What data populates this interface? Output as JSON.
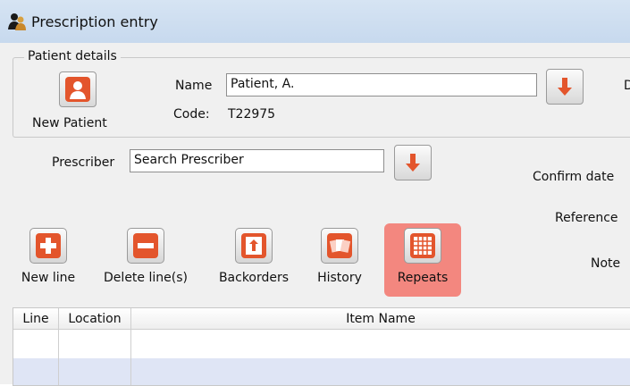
{
  "window": {
    "title": "Prescription entry",
    "app_icon": "people-icon"
  },
  "patient_details": {
    "legend": "Patient details",
    "new_patient_label": "New Patient",
    "name_label": "Name",
    "name_value": "Patient, A.",
    "code_label": "Code:",
    "code_value": "T22975",
    "cut_label": "D"
  },
  "prescriber": {
    "label": "Prescriber",
    "value": "Search Prescriber"
  },
  "right_labels": {
    "confirm_date": "Confirm date",
    "reference": "Reference",
    "note": "Note"
  },
  "toolbar": {
    "new_line": "New line",
    "delete_lines": "Delete line(s)",
    "backorders": "Backorders",
    "history": "History",
    "repeats": "Repeats"
  },
  "table": {
    "columns": [
      "Line",
      "Location",
      "Item Name"
    ],
    "rows": [
      [],
      []
    ]
  },
  "colors": {
    "highlight": "#f3877f",
    "accent_red": "#e3552c",
    "row_alt": "#dfe5f5"
  }
}
